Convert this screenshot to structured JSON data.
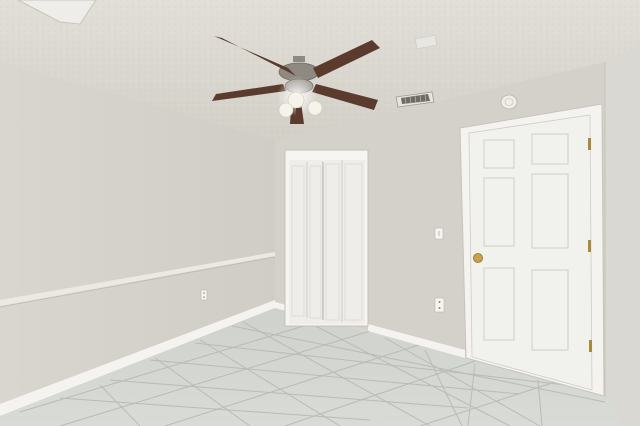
{
  "scene": {
    "colors": {
      "ceiling": "#dedbd4",
      "wall_left": "#d6d4cc",
      "wall_back": "#d3d1ca",
      "wall_right": "#d9d7d1",
      "floor_tile": "#cfd1cd",
      "grout": "#b8bab6",
      "trim": "#f4f3ef",
      "door": "#f2f2ef",
      "fan_blade": "#5a3b2d",
      "fan_metal": "#8e8a82",
      "light_glass": "#f6f4ea"
    },
    "icons": [
      "ceiling-fan-icon",
      "smoke-detector-icon",
      "air-vent-icon",
      "door-knob-icon",
      "outlet-icon",
      "light-switch-icon"
    ]
  }
}
